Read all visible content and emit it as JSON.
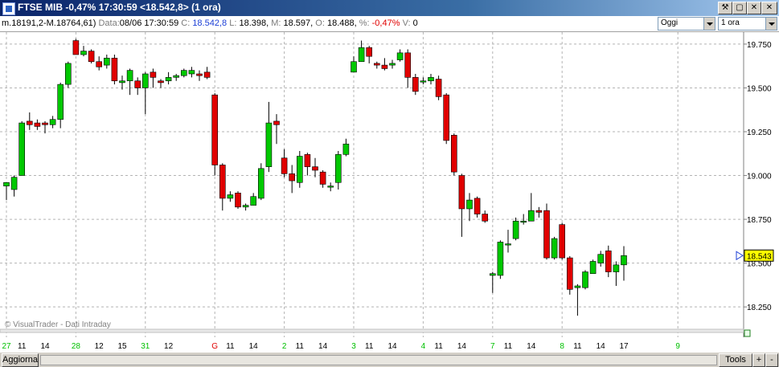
{
  "window": {
    "title": "FTSE MIB -0,47% 17:30:59  <18.542,8> (1 ora)",
    "buttons": [
      "⚒",
      "▢",
      "✕",
      "-",
      "□",
      "✕"
    ]
  },
  "infobar": {
    "ma_text": "m.18191,2-M.18764,61)",
    "date_label": "Data:",
    "date_value": "08/06 17:30:59",
    "close_label": "C:",
    "close_value": "18.542,8",
    "low_label": "L:",
    "low_value": "18.398,",
    "high_label": "M:",
    "high_value": "18.597,",
    "open_label": "O:",
    "open_value": "18.488,",
    "pct_label": "%:",
    "pct_value": "-0,47%",
    "vol_label": "V:",
    "vol_value": "0",
    "period_select": "Oggi",
    "interval_select": "1 ora"
  },
  "watermark": "© VisualTrader - Dati Intraday",
  "last_price_tag": "18.543",
  "bottom": {
    "refresh_button": "Aggiorna",
    "tools_button": "Tools",
    "plus_button": "+",
    "minus_button": "-"
  },
  "colors": {
    "up": "#00c800",
    "down": "#e00000",
    "grid": "#b4b4b4",
    "price_tag_bg": "#ffff00"
  },
  "chart_data": {
    "type": "candlestick",
    "ylim": [
      18150,
      19800
    ],
    "y_ticks": [
      "19.750",
      "19.500",
      "19.250",
      "19.000",
      "18.750",
      "18.500",
      "18.250"
    ],
    "y_tick_values": [
      19750,
      19500,
      19250,
      19000,
      18750,
      18500,
      18250
    ],
    "x_ticks": [
      {
        "label": "27",
        "i": 0,
        "color": "green"
      },
      {
        "label": "11",
        "i": 2,
        "color": "black"
      },
      {
        "label": "14",
        "i": 5,
        "color": "black"
      },
      {
        "label": "28",
        "i": 9,
        "color": "green"
      },
      {
        "label": "12",
        "i": 12,
        "color": "black"
      },
      {
        "label": "15",
        "i": 15,
        "color": "black"
      },
      {
        "label": "31",
        "i": 18,
        "color": "green"
      },
      {
        "label": "12",
        "i": 21,
        "color": "black"
      },
      {
        "label": "G",
        "i": 27,
        "color": "red"
      },
      {
        "label": "11",
        "i": 29,
        "color": "black"
      },
      {
        "label": "14",
        "i": 32,
        "color": "black"
      },
      {
        "label": "2",
        "i": 36,
        "color": "green"
      },
      {
        "label": "11",
        "i": 38,
        "color": "black"
      },
      {
        "label": "14",
        "i": 41,
        "color": "black"
      },
      {
        "label": "3",
        "i": 45,
        "color": "green"
      },
      {
        "label": "11",
        "i": 47,
        "color": "black"
      },
      {
        "label": "14",
        "i": 50,
        "color": "black"
      },
      {
        "label": "4",
        "i": 54,
        "color": "green"
      },
      {
        "label": "11",
        "i": 56,
        "color": "black"
      },
      {
        "label": "14",
        "i": 59,
        "color": "black"
      },
      {
        "label": "7",
        "i": 63,
        "color": "green"
      },
      {
        "label": "11",
        "i": 65,
        "color": "black"
      },
      {
        "label": "14",
        "i": 68,
        "color": "black"
      },
      {
        "label": "8",
        "i": 72,
        "color": "green"
      },
      {
        "label": "11",
        "i": 74,
        "color": "black"
      },
      {
        "label": "14",
        "i": 77,
        "color": "black"
      },
      {
        "label": "17",
        "i": 80,
        "color": "black"
      },
      {
        "label": "9",
        "i": 87,
        "color": "green"
      }
    ],
    "candles": [
      [
        18940,
        18960,
        18860,
        18940
      ],
      [
        18920,
        18990,
        18880,
        19000
      ],
      [
        19000,
        19300,
        19000,
        19310
      ],
      [
        19310,
        19290,
        19260,
        19360
      ],
      [
        19300,
        19280,
        19260,
        19320
      ],
      [
        19300,
        19290,
        19240,
        19310
      ],
      [
        19290,
        19320,
        19270,
        19340
      ],
      [
        19320,
        19520,
        19270,
        19530
      ],
      [
        19520,
        19640,
        19500,
        19650
      ],
      [
        19770,
        19690,
        19690,
        19780
      ],
      [
        19690,
        19710,
        19680,
        19740
      ],
      [
        19710,
        19650,
        19640,
        19720
      ],
      [
        19650,
        19620,
        19600,
        19680
      ],
      [
        19630,
        19670,
        19610,
        19690
      ],
      [
        19670,
        19540,
        19520,
        19690
      ],
      [
        19530,
        19540,
        19490,
        19570
      ],
      [
        19540,
        19600,
        19460,
        19610
      ],
      [
        19540,
        19500,
        19460,
        19560
      ],
      [
        19500,
        19580,
        19350,
        19590
      ],
      [
        19590,
        19560,
        19500,
        19610
      ],
      [
        19540,
        19530,
        19500,
        19550
      ],
      [
        19540,
        19560,
        19520,
        19590
      ],
      [
        19560,
        19570,
        19540,
        19580
      ],
      [
        19570,
        19600,
        19560,
        19610
      ],
      [
        19580,
        19600,
        19560,
        19620
      ],
      [
        19580,
        19570,
        19540,
        19600
      ],
      [
        19590,
        19560,
        19550,
        19620
      ],
      [
        19460,
        19060,
        19000,
        19470
      ],
      [
        19060,
        18870,
        18800,
        19070
      ],
      [
        18870,
        18890,
        18850,
        18910
      ],
      [
        18900,
        18820,
        18810,
        18910
      ],
      [
        18820,
        18830,
        18800,
        18840
      ],
      [
        18830,
        18880,
        18830,
        18900
      ],
      [
        18870,
        19040,
        18860,
        19070
      ],
      [
        19050,
        19300,
        19020,
        19420
      ],
      [
        19310,
        19290,
        19180,
        19350
      ],
      [
        19100,
        19010,
        18990,
        19150
      ],
      [
        19010,
        18970,
        18900,
        19060
      ],
      [
        18960,
        19110,
        18930,
        19140
      ],
      [
        19120,
        19050,
        19000,
        19130
      ],
      [
        19050,
        19030,
        18990,
        19100
      ],
      [
        19020,
        18950,
        18930,
        19030
      ],
      [
        18940,
        18940,
        18910,
        18960
      ],
      [
        18960,
        19120,
        18920,
        19140
      ],
      [
        19120,
        19180,
        19110,
        19210
      ],
      [
        19590,
        19650,
        19590,
        19680
      ],
      [
        19650,
        19730,
        19650,
        19770
      ],
      [
        19730,
        19680,
        19640,
        19740
      ],
      [
        19640,
        19630,
        19610,
        19650
      ],
      [
        19630,
        19610,
        19600,
        19670
      ],
      [
        19630,
        19640,
        19610,
        19660
      ],
      [
        19660,
        19700,
        19650,
        19720
      ],
      [
        19700,
        19560,
        19500,
        19720
      ],
      [
        19560,
        19480,
        19460,
        19580
      ],
      [
        19540,
        19540,
        19520,
        19560
      ],
      [
        19540,
        19560,
        19520,
        19580
      ],
      [
        19550,
        19450,
        19430,
        19570
      ],
      [
        19460,
        19200,
        19180,
        19470
      ],
      [
        19230,
        19020,
        19000,
        19240
      ],
      [
        19000,
        18810,
        18650,
        19010
      ],
      [
        18810,
        18860,
        18740,
        18900
      ],
      [
        18870,
        18780,
        18760,
        18880
      ],
      [
        18780,
        18740,
        18730,
        18800
      ],
      [
        18430,
        18440,
        18330,
        18450
      ],
      [
        18430,
        18620,
        18410,
        18630
      ],
      [
        18610,
        18610,
        18560,
        18690
      ],
      [
        18640,
        18740,
        18630,
        18760
      ],
      [
        18740,
        18740,
        18720,
        18780
      ],
      [
        18740,
        18800,
        18740,
        18900
      ],
      [
        18800,
        18790,
        18760,
        18820
      ],
      [
        18800,
        18530,
        18520,
        18840
      ],
      [
        18530,
        18640,
        18520,
        18650
      ],
      [
        18720,
        18530,
        18520,
        18730
      ],
      [
        18530,
        18350,
        18320,
        18540
      ],
      [
        18360,
        18370,
        18200,
        18380
      ],
      [
        18360,
        18450,
        18350,
        18460
      ],
      [
        18440,
        18510,
        18440,
        18520
      ],
      [
        18500,
        18550,
        18480,
        18570
      ],
      [
        18570,
        18450,
        18420,
        18600
      ],
      [
        18450,
        18490,
        18370,
        18510
      ],
      [
        18490,
        18543,
        18400,
        18597
      ]
    ]
  }
}
